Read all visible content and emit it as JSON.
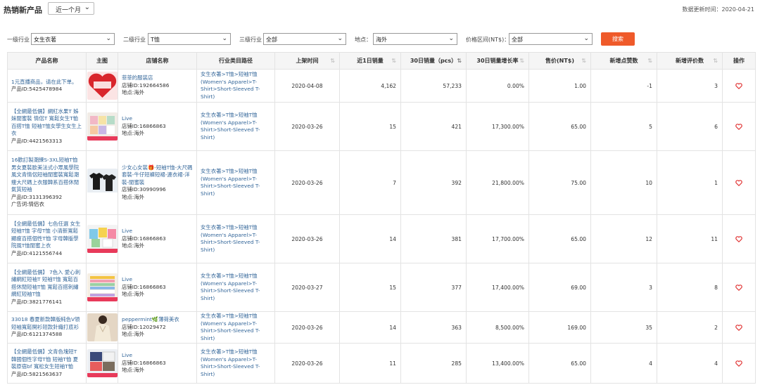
{
  "header": {
    "title": "热销新产品",
    "period": "近一个月",
    "updated": "数据更新时间：2020-04-21"
  },
  "filters": {
    "level1_label": "一级行业",
    "level1_value": "女生衣著",
    "level2_label": "二级行业",
    "level2_value": "T恤",
    "level3_label": "三级行业",
    "level3_value": "全部",
    "location_label": "地点：",
    "location_value": "海外",
    "price_label": "价格区间(NT$)：",
    "price_value": "全部",
    "search_button": "搜索"
  },
  "columns": [
    "产品名称",
    "主图",
    "店铺名称",
    "行业类目路径",
    "上架时间",
    "近1日销量",
    "30日销量（pcs）",
    "30日销量增长率",
    "售价(NT$)",
    "新增点赞数",
    "新增评价数",
    "操作"
  ],
  "rows": [
    {
      "name": "1元直播商品，请在此下单。",
      "product_id": "产品ID:5425478984",
      "ad_word": "",
      "store": "菲菲的服装店",
      "store_id": "店铺ID:192664586",
      "location": "地点:海外",
      "category": "女生衣著>T恤>短袖T恤 (Women's Apparel>T-Shirt>Short-Sleeved T-Shirt)",
      "date": "2020-04-08",
      "sales_1d": "4,162",
      "sales_30d": "57,233",
      "growth": "0.00%",
      "price": "1.00",
      "likes": "-1",
      "reviews": "3",
      "thumb": "red-heart",
      "thumb_text": "1元直播商品\n请在此下单"
    },
    {
      "name": "【全網最低價】網紅水果T 姊妹閨蜜裝 情侶T 寬鬆女生T恤 百搭T恤 短袖T恤女學生女生上衣",
      "product_id": "产品ID:4421563313",
      "ad_word": "",
      "store": "Live",
      "store_id": "店铺ID:16866863",
      "location": "地点:海外",
      "category": "女生衣著>T恤>短袖T恤 (Women's Apparel>T-Shirt>Short-Sleeved T-Shirt)",
      "date": "2020-03-26",
      "sales_1d": "15",
      "sales_30d": "421",
      "growth": "17,300.00%",
      "price": "65.00",
      "likes": "5",
      "reviews": "6",
      "thumb": "colorful-tees",
      "thumb_text": ""
    },
    {
      "name": "16歡訂製潮練S-3XL短袖T恤 男女夏裝歐美法式小眾風學院風文青情侶短袖閨蜜裝寬鬆潮痩大尺碼上衣服韓系百搭休閒氣質短袖",
      "product_id": "产品ID:3131396392",
      "ad_word": "广告词:情侣衣",
      "store": "少女心女裝🎁-短袖T恤-大尺碼套裝-牛仔短褲短裙-連衣裙-洋裝-閨蜜裝",
      "store_id": "店铺ID:30990996",
      "location": "地点:海外",
      "category": "女生衣著>T恤>短袖T恤 (Women's Apparel>T-Shirt>Short-Sleeved T-Shirt)",
      "date": "2020-03-26",
      "sales_1d": "7",
      "sales_30d": "392",
      "growth": "21,800.00%",
      "price": "75.00",
      "likes": "10",
      "reviews": "1",
      "thumb": "black-tees",
      "thumb_text": ""
    },
    {
      "name": "【全網最低價】七色任選 女生短袖T恤 字母T恤 小清新寬鬆顯瘦百搭個性T恤 字母韓版學院風T恤閨蜜上衣",
      "product_id": "产品ID:4121556744",
      "ad_word": "",
      "store": "Live",
      "store_id": "店铺ID:16866863",
      "location": "地点:海外",
      "category": "女生衣著>T恤>短袖T恤 (Women's Apparel>T-Shirt>Short-Sleeved T-Shirt)",
      "date": "2020-03-26",
      "sales_1d": "14",
      "sales_30d": "381",
      "growth": "17,700.00%",
      "price": "65.00",
      "likes": "12",
      "reviews": "11",
      "thumb": "letter-tees",
      "thumb_text": ""
    },
    {
      "name": "【全網最低價】 7色入 愛心刺繡網紅短袖T 短袖T恤 寬鬆百搭休閒短袖T恤 寬鬆百搭刺繡網紅短袖T恤",
      "product_id": "产品ID:3821776141",
      "ad_word": "",
      "store": "Live",
      "store_id": "店铺ID:16866863",
      "location": "地点:海外",
      "category": "女生衣著>T恤>短袖T恤 (Women's Apparel>T-Shirt>Short-Sleeved T-Shirt)",
      "date": "2020-03-27",
      "sales_1d": "15",
      "sales_30d": "377",
      "growth": "17,400.00%",
      "price": "69.00",
      "likes": "3",
      "reviews": "8",
      "thumb": "stacked-tees",
      "thumb_text": ""
    },
    {
      "name": "33018 春夏新款韓版純色V領短袖寬鬆開衫短款針織打底衫",
      "product_id": "产品ID:6121374588",
      "ad_word": "",
      "store": "peppermint🌿薄荷美衣",
      "store_id": "店铺ID:12029472",
      "location": "地点:海外",
      "category": "女生衣著>T恤>短袖T恤 (Women's Apparel>T-Shirt>Short-Sleeved T-Shirt)",
      "date": "2020-03-26",
      "sales_1d": "14",
      "sales_30d": "363",
      "growth": "8,500.00%",
      "price": "169.00",
      "likes": "35",
      "reviews": "2",
      "thumb": "model-photo",
      "thumb_text": ""
    },
    {
      "name": "【全網最低價】文青色塊短T 韓國個性字母T恤 短袖T恤 夏裝原宿bf 寬松女生短袖T恤",
      "product_id": "产品ID:5821563637",
      "ad_word": "",
      "store": "Live",
      "store_id": "店铺ID:16866863",
      "location": "地点:海外",
      "category": "女生衣著>T恤>短袖T恤 (Women's Apparel>T-Shirt>Short-Sleeved T-Shirt)",
      "date": "2020-03-26",
      "sales_1d": "11",
      "sales_30d": "285",
      "growth": "13,400.00%",
      "price": "65.00",
      "likes": "4",
      "reviews": "4",
      "thumb": "colorblock-tees",
      "thumb_text": ""
    }
  ],
  "colors": {
    "accent": "#ef5a2a",
    "link": "#336699",
    "heart": "#e03030"
  }
}
